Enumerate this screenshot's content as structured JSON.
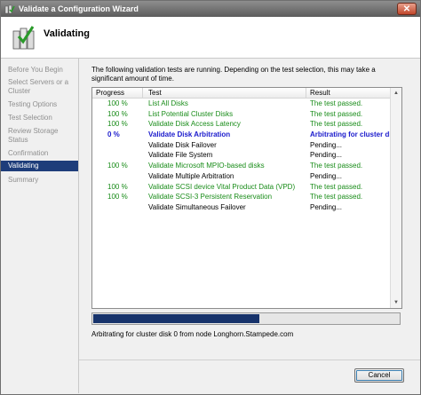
{
  "window": {
    "title": "Validate a Configuration Wizard"
  },
  "header": {
    "page_title": "Validating"
  },
  "nav": {
    "items": [
      {
        "label": "Before You Begin"
      },
      {
        "label": "Select Servers or a Cluster"
      },
      {
        "label": "Testing Options"
      },
      {
        "label": "Test Selection"
      },
      {
        "label": "Review Storage Status"
      },
      {
        "label": "Confirmation"
      },
      {
        "label": "Validating"
      },
      {
        "label": "Summary"
      }
    ],
    "active_index": 6
  },
  "main": {
    "description": "The following validation tests are running. Depending on the test selection, this may take a significant amount of time.",
    "columns": {
      "progress": "Progress",
      "test": "Test",
      "result": "Result"
    },
    "rows": [
      {
        "progress": "100 %",
        "test": "List All Disks",
        "result": "The test passed.",
        "state": "pass"
      },
      {
        "progress": "100 %",
        "test": "List Potential Cluster Disks",
        "result": "The test passed.",
        "state": "pass"
      },
      {
        "progress": "100 %",
        "test": "Validate Disk Access Latency",
        "result": "The test passed.",
        "state": "pass"
      },
      {
        "progress": "0 %",
        "test": "Validate Disk Arbitration",
        "result": "Arbitrating for cluster disk",
        "state": "active"
      },
      {
        "progress": "",
        "test": "Validate Disk Failover",
        "result": "Pending...",
        "state": "pending"
      },
      {
        "progress": "",
        "test": "Validate File System",
        "result": "Pending...",
        "state": "pending"
      },
      {
        "progress": "100 %",
        "test": "Validate Microsoft MPIO-based disks",
        "result": "The test passed.",
        "state": "pass"
      },
      {
        "progress": "",
        "test": "Validate Multiple Arbitration",
        "result": "Pending...",
        "state": "pending"
      },
      {
        "progress": "100 %",
        "test": "Validate SCSI device Vital Product Data (VPD)",
        "result": "The test passed.",
        "state": "pass"
      },
      {
        "progress": "100 %",
        "test": "Validate SCSI-3 Persistent Reservation",
        "result": "The test passed.",
        "state": "pass"
      },
      {
        "progress": "",
        "test": "Validate Simultaneous Failover",
        "result": "Pending...",
        "state": "pending"
      }
    ],
    "overall_progress": 0.54,
    "status_text": "Arbitrating for cluster disk 0 from node Longhorn.Stampede.com"
  },
  "footer": {
    "cancel_label": "Cancel"
  },
  "colors": {
    "accent": "#1e3d7a",
    "pass": "#198c19",
    "active": "#1a1acc",
    "progress_fill": "#17336b"
  },
  "icons": {
    "app": "cluster-wizard-icon",
    "close": "close-icon",
    "scroll_up": "scroll-up-arrow-icon",
    "scroll_down": "scroll-down-arrow-icon"
  }
}
